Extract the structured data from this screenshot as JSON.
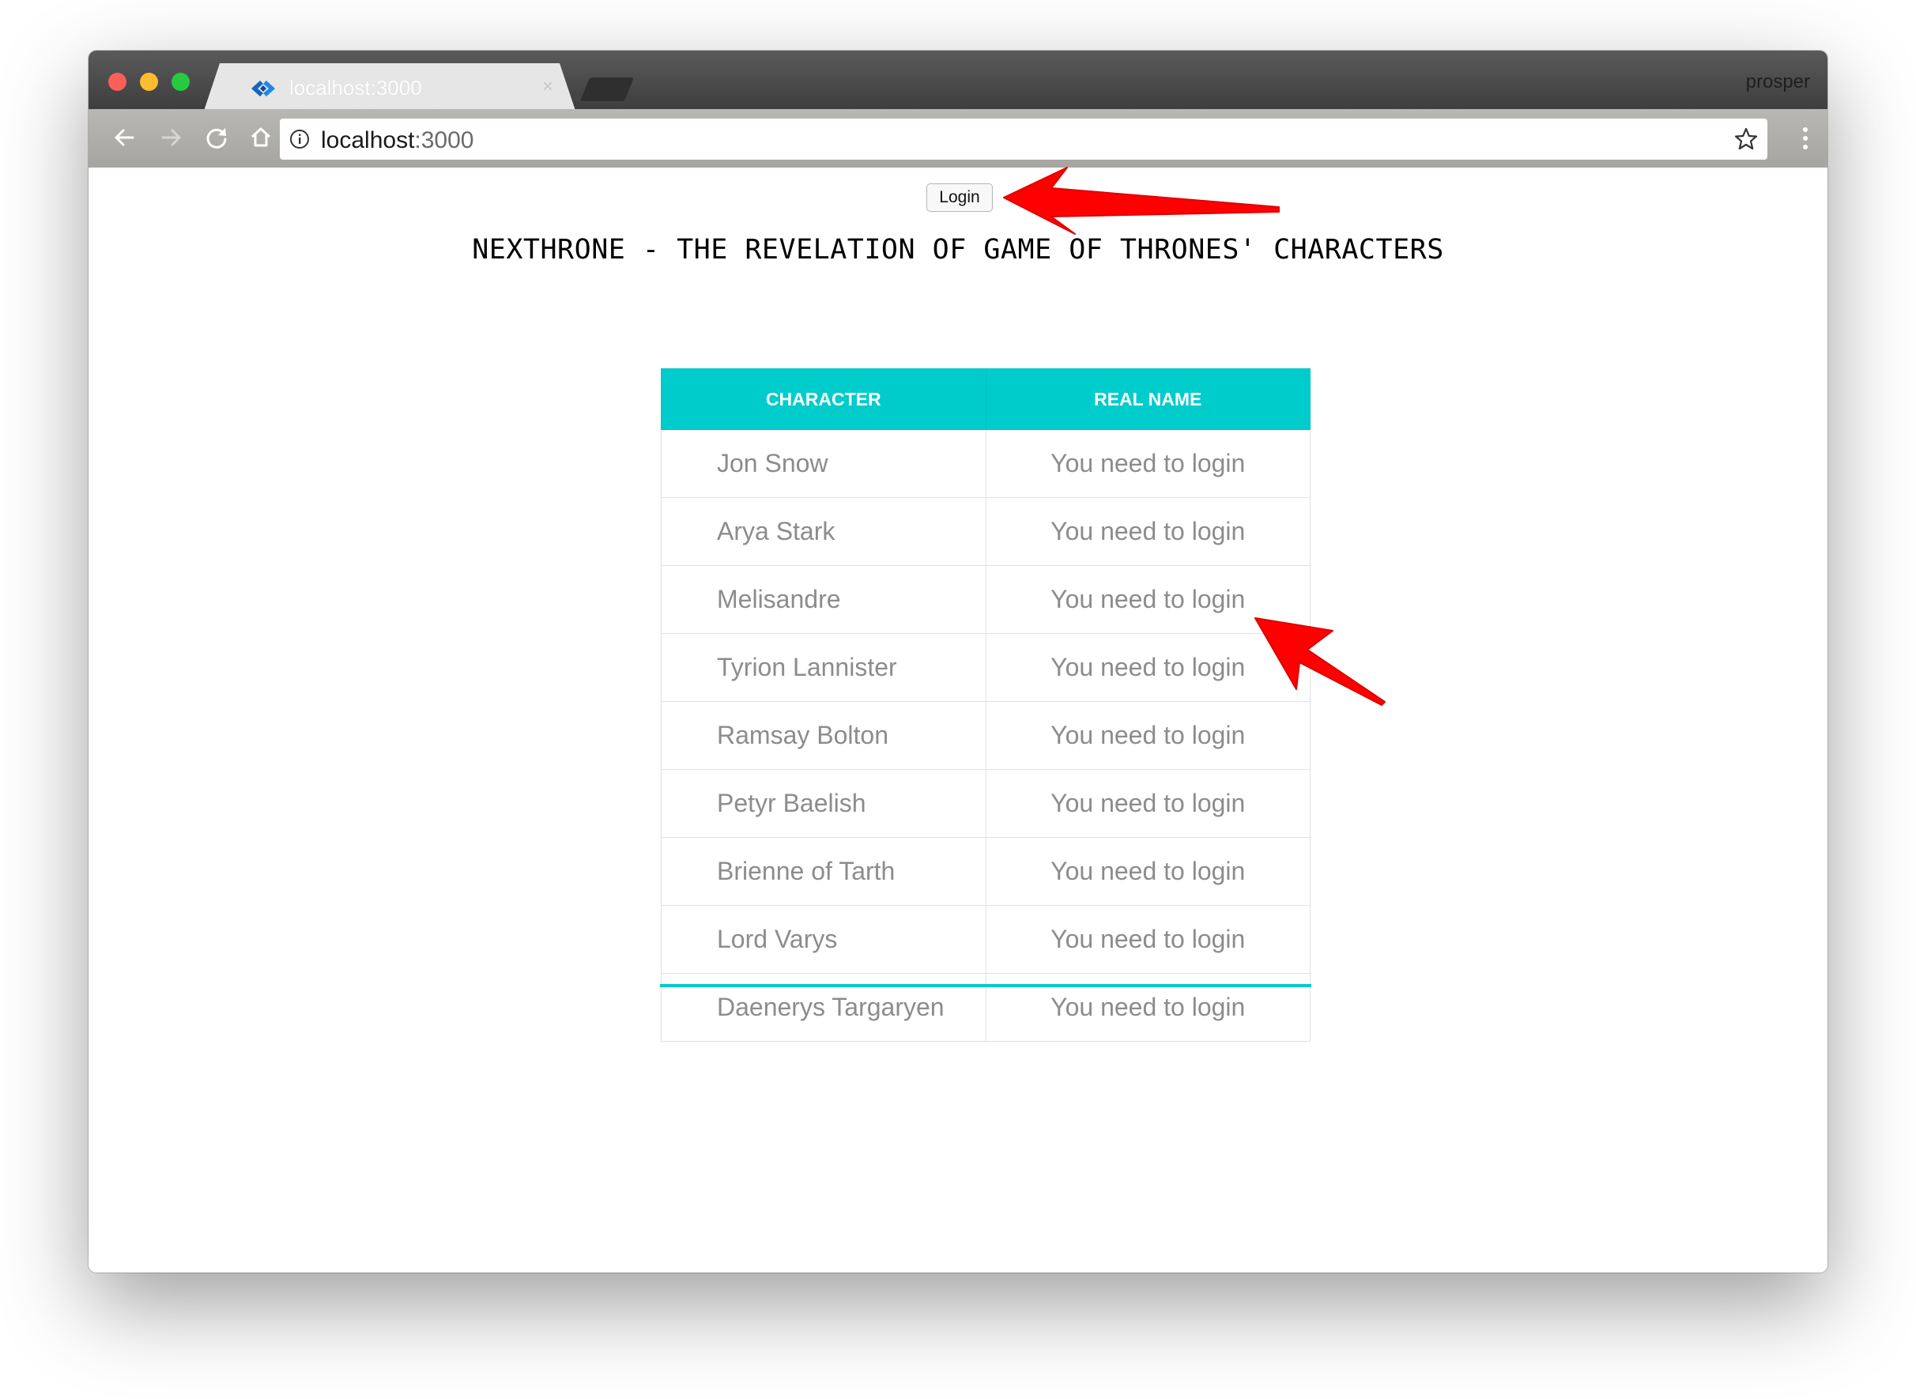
{
  "browser": {
    "tab_title": "localhost:3000",
    "favicon": "next-logo-icon",
    "profile_name": "prosper",
    "address_host": "localhost",
    "address_port": ":3000"
  },
  "page": {
    "login_label": "Login",
    "title": "NEXTHRONE - THE REVELATION OF GAME OF THRONES' CHARACTERS",
    "table": {
      "headers": [
        "CHARACTER",
        "REAL NAME"
      ],
      "rows": [
        [
          "Jon Snow",
          "You need to login"
        ],
        [
          "Arya Stark",
          "You need to login"
        ],
        [
          "Melisandre",
          "You need to login"
        ],
        [
          "Tyrion Lannister",
          "You need to login"
        ],
        [
          "Ramsay Bolton",
          "You need to login"
        ],
        [
          "Petyr Baelish",
          "You need to login"
        ],
        [
          "Brienne of Tarth",
          "You need to login"
        ],
        [
          "Lord Varys",
          "You need to login"
        ],
        [
          "Daenerys Targaryen",
          "You need to login"
        ]
      ]
    }
  },
  "colors": {
    "table_header": "#00cccc",
    "cell_text": "#8c8c8c",
    "annotation_arrow": "#ff0000"
  }
}
